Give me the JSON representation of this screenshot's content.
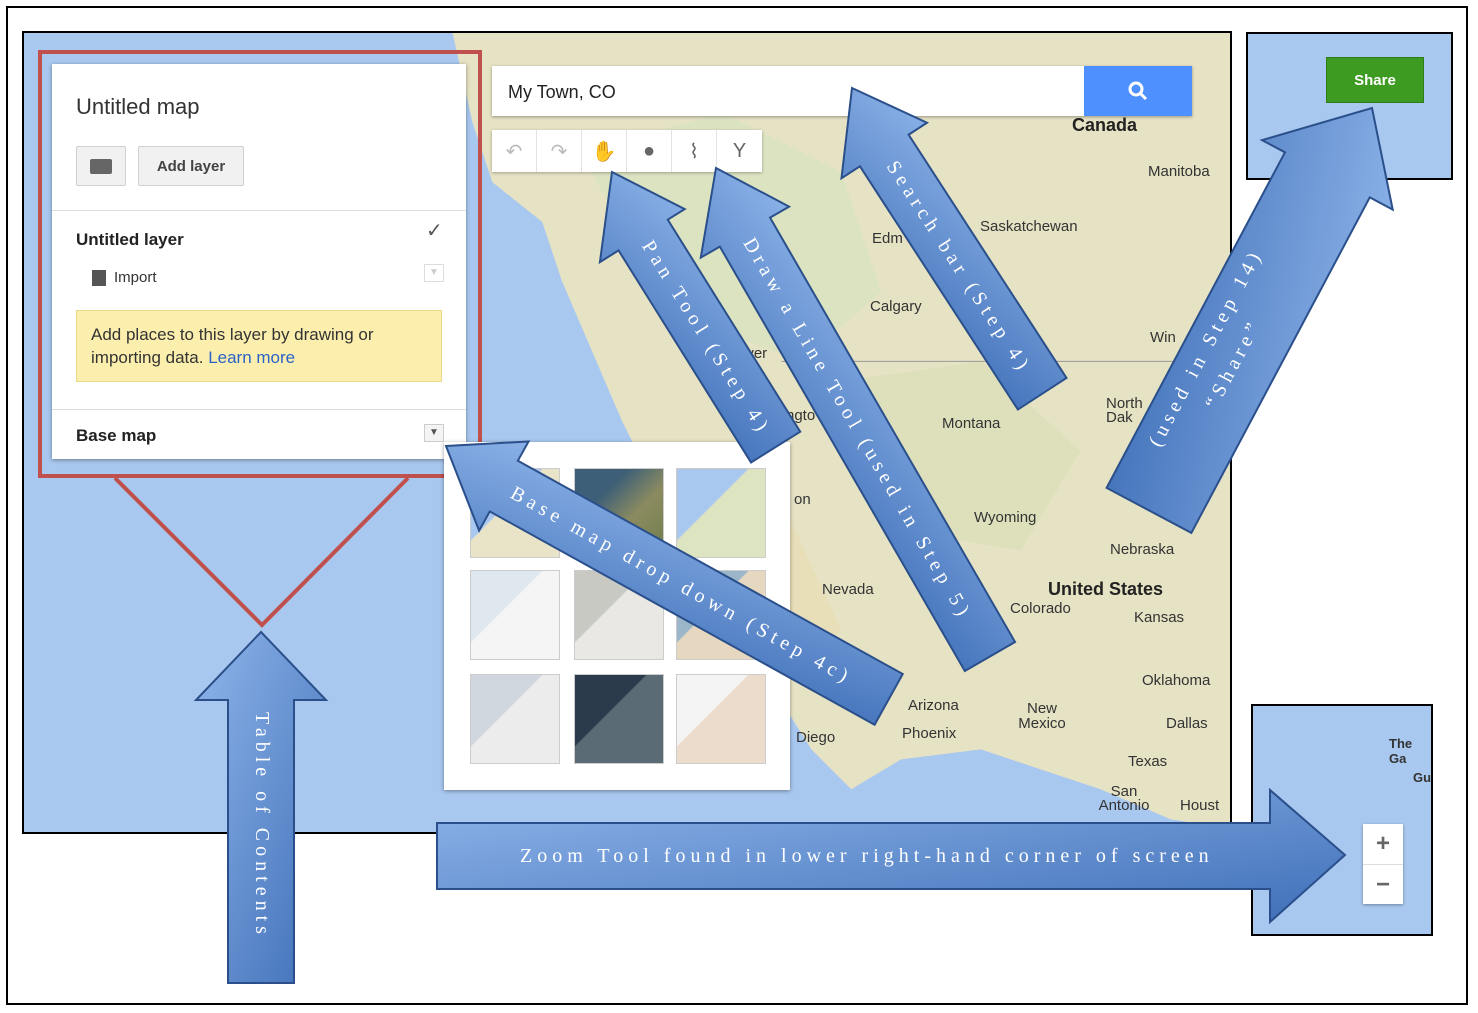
{
  "map": {
    "labels": [
      {
        "id": "canada",
        "text": "Canada",
        "big": true
      },
      {
        "id": "manitoba",
        "text": "Manitoba"
      },
      {
        "id": "saskatchewan",
        "text": "Saskatchewan"
      },
      {
        "id": "edmonton",
        "text": "Edm"
      },
      {
        "id": "calgary",
        "text": "Calgary"
      },
      {
        "id": "winnipeg",
        "text": "Win"
      },
      {
        "id": "montana",
        "text": "Montana"
      },
      {
        "id": "north-dakota",
        "text": "North Dak"
      },
      {
        "id": "wyoming",
        "text": "Wyoming"
      },
      {
        "id": "nebraska",
        "text": "Nebraska"
      },
      {
        "id": "united-states",
        "text": "United States",
        "big": true
      },
      {
        "id": "colorado",
        "text": "Colorado"
      },
      {
        "id": "kansas",
        "text": "Kansas"
      },
      {
        "id": "nevada",
        "text": "Nevada"
      },
      {
        "id": "oklahoma",
        "text": "Oklahoma"
      },
      {
        "id": "arizona",
        "text": "Arizona"
      },
      {
        "id": "new-mexico",
        "text": "New Mexico"
      },
      {
        "id": "phoenix",
        "text": "Phoenix"
      },
      {
        "id": "dallas",
        "text": "Dallas"
      },
      {
        "id": "texas",
        "text": "Texas"
      },
      {
        "id": "san-antonio",
        "text": "San Antonio"
      },
      {
        "id": "houston",
        "text": "Houst"
      },
      {
        "id": "san-diego",
        "text": "Diego"
      },
      {
        "id": "vancouver",
        "text": "uver"
      },
      {
        "id": "washington",
        "text": "ngto"
      },
      {
        "id": "oregon",
        "text": "on"
      }
    ]
  },
  "panel": {
    "title": "Untitled map",
    "add_layer": "Add layer",
    "layer_title": "Untitled layer",
    "import": "Import",
    "note_text": "Add places to this layer by drawing or importing data.",
    "note_link": "Learn more",
    "base_map": "Base map"
  },
  "search": {
    "value": "My Town, CO"
  },
  "share": {
    "label": "Share"
  },
  "zoom": {
    "plus": "+",
    "minus": "−",
    "label1": "The Ga",
    "label2": "Guine"
  },
  "annotations": {
    "pan_tool": "Pan Tool (Step 4)",
    "draw_line_tool": "Draw a Line Tool (used in Step 5)",
    "search_bar": "Search bar (Step 4)",
    "share_line1": "“Share”",
    "share_line2": "(used in Step 14)",
    "base_map_dropdown": "Base map drop down (Step 4c)",
    "table_of_contents": "Table of Contents",
    "zoom_tool": "Zoom Tool found in lower right-hand corner of screen"
  },
  "colors": {
    "accent_blue": "#4d90fe",
    "share_green": "#3d9b22",
    "annotation_red": "#c0504d",
    "arrow_blue": "#4f81bd",
    "water": "#a9c8ef",
    "land": "#e8e4c9"
  }
}
